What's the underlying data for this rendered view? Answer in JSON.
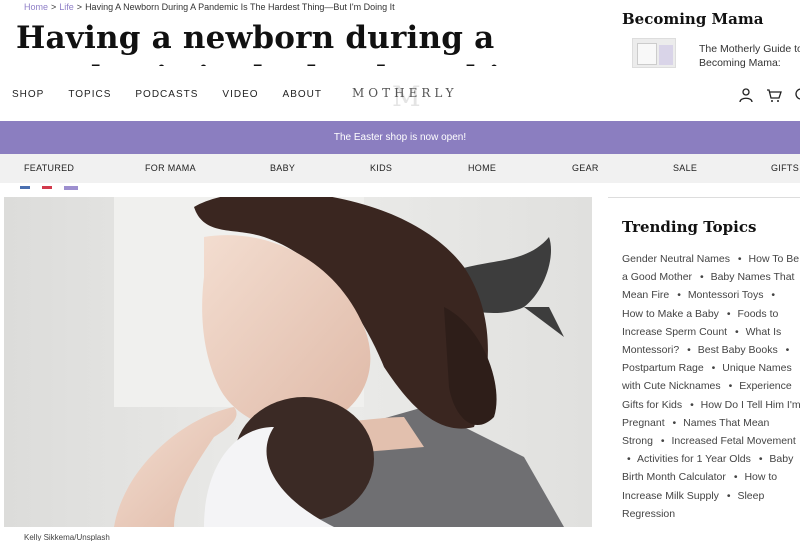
{
  "breadcrumb": {
    "home": "Home",
    "sep1": ">",
    "life": "Life",
    "sep2": ">",
    "current": "Having A Newborn During A Pandemic Is The Hardest Thing—But I'm Doing It"
  },
  "article": {
    "headline": "Having a newborn during a pandemic is the hardest thing I've ever done",
    "photo_credit": "Kelly Sikkema/Unsplash"
  },
  "promo": {
    "title": "Becoming Mama",
    "text": "The Motherly Guide to Becoming Mama:"
  },
  "nav": {
    "links": [
      "SHOP",
      "TOPICS",
      "PODCASTS",
      "VIDEO",
      "ABOUT"
    ],
    "logo": "MOTHERLY",
    "logo_mark": "M",
    "icons": [
      "user-icon",
      "cart-icon",
      "search-icon"
    ]
  },
  "announcement": "The Easter shop is now open!",
  "categories": [
    "FEATURED",
    "FOR MAMA",
    "BABY",
    "KIDS",
    "HOME",
    "GEAR",
    "SALE",
    "GIFTS"
  ],
  "trending": {
    "title": "Trending Topics",
    "items": [
      "Gender Neutral Names",
      "How To Be a Good Mother",
      "Baby Names That Mean Fire",
      "Montessori Toys",
      "How to Make a Baby",
      "Foods to Increase Sperm Count",
      "What Is Montessori?",
      "Best Baby Books",
      "Postpartum Rage",
      "Unique Names with Cute Nicknames",
      "Experience Gifts for Kids",
      "How Do I Tell Him I'm Pregnant",
      "Names That Mean Strong",
      "Increased Fetal Movement",
      "Activities for 1 Year Olds",
      "Baby Birth Month Calculator",
      "How to Increase Milk Supply",
      "Sleep Regression"
    ]
  },
  "colors": {
    "brand_purple": "#8b7ec0",
    "link_purple": "#8f7fc7",
    "category_bar": "#f1f1f1"
  }
}
